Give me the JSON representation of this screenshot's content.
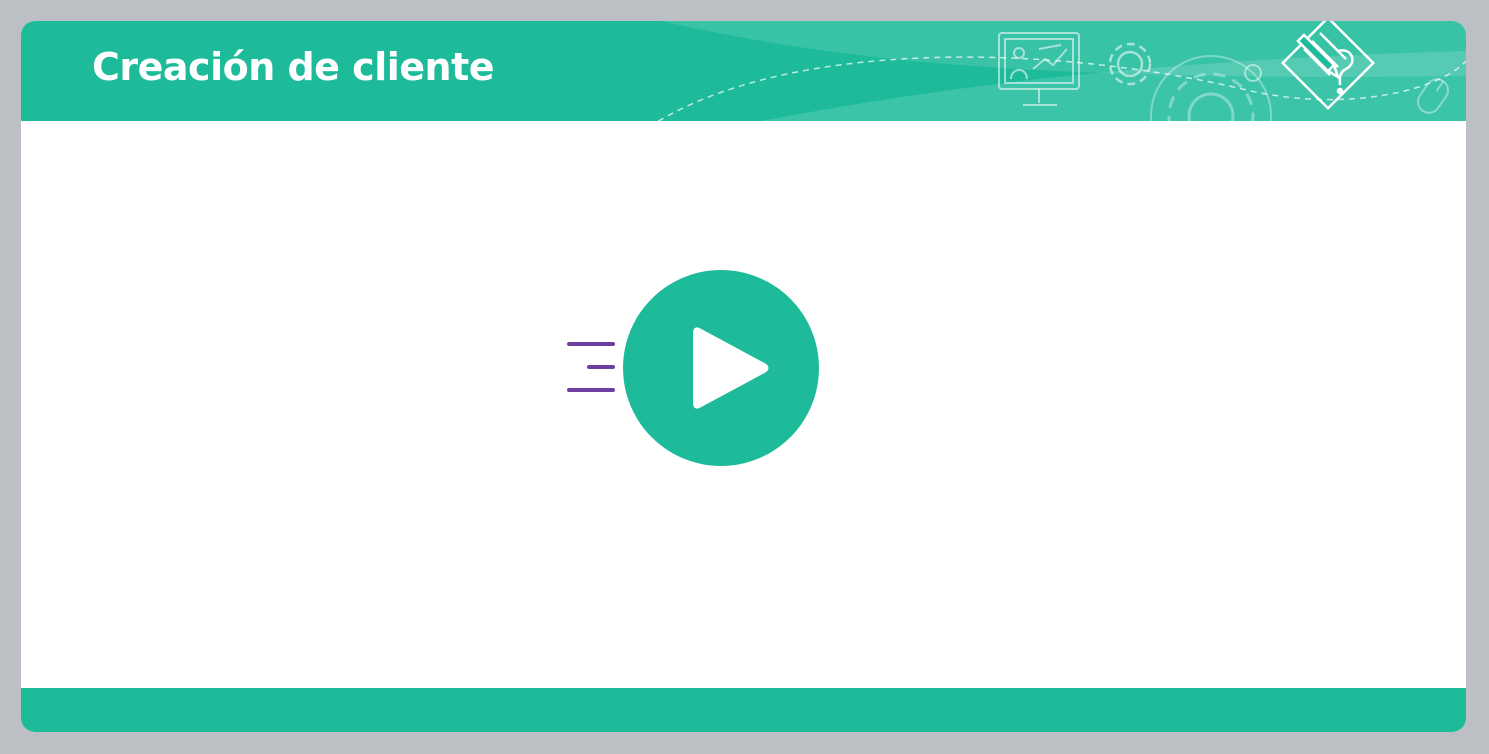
{
  "header": {
    "title": "Creación de cliente"
  },
  "icons": {
    "decor": [
      "presentation-monitor-icon",
      "gear-icon",
      "large-gear-icon",
      "edit-document-icon",
      "mouse-icon"
    ],
    "play": "play-icon",
    "speed": "speed-lines-icon"
  },
  "colors": {
    "background": "#bcc0c4",
    "accent": "#1dbb9a",
    "speed_lines": "#6e3fa3",
    "surface": "#ffffff"
  }
}
